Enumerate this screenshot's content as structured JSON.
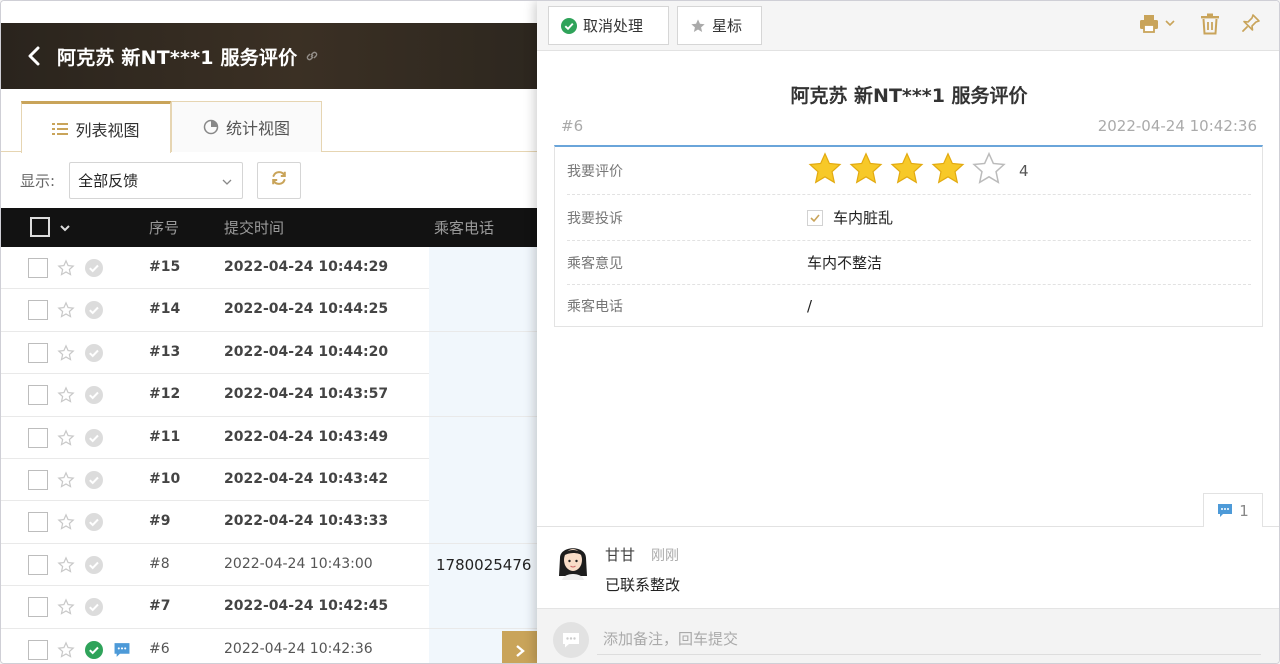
{
  "header": {
    "title": "阿克苏 新NT***1 服务评价"
  },
  "tabs": [
    {
      "label": "列表视图",
      "active": true
    },
    {
      "label": "统计视图",
      "active": false
    }
  ],
  "filter": {
    "label": "显示:",
    "selected": "全部反馈"
  },
  "table": {
    "columns": {
      "seq": "序号",
      "time": "提交时间",
      "phone": "乘客电话"
    },
    "rows": [
      {
        "seq": "#15",
        "time": "2022-04-24 10:44:29",
        "phone": "",
        "unread": true
      },
      {
        "seq": "#14",
        "time": "2022-04-24 10:44:25",
        "phone": "",
        "unread": true
      },
      {
        "seq": "#13",
        "time": "2022-04-24 10:44:20",
        "phone": "",
        "unread": true
      },
      {
        "seq": "#12",
        "time": "2022-04-24 10:43:57",
        "phone": "",
        "unread": true
      },
      {
        "seq": "#11",
        "time": "2022-04-24 10:43:49",
        "phone": "",
        "unread": true
      },
      {
        "seq": "#10",
        "time": "2022-04-24 10:43:42",
        "phone": "",
        "unread": true
      },
      {
        "seq": "#9",
        "time": "2022-04-24 10:43:33",
        "phone": "",
        "unread": true
      },
      {
        "seq": "#8",
        "time": "2022-04-24 10:43:00",
        "phone": "1780025476",
        "unread": false
      },
      {
        "seq": "#7",
        "time": "2022-04-24 10:42:45",
        "phone": "",
        "unread": true
      },
      {
        "seq": "#6",
        "time": "2022-04-24 10:42:36",
        "phone": "",
        "unread": false,
        "selected": true
      }
    ]
  },
  "toolbar": {
    "cancel_label": "取消处理",
    "star_label": "星标"
  },
  "detail": {
    "title": "阿克苏 新NT***1 服务评价",
    "id": "#6",
    "date": "2022-04-24 10:42:36",
    "fields": {
      "rating_label": "我要评价",
      "rating_value": "4",
      "rating_max": 5,
      "complaint_label": "我要投诉",
      "complaint_value": "车内脏乱",
      "opinion_label": "乘客意见",
      "opinion_value": "车内不整洁",
      "phone_label": "乘客电话",
      "phone_value": "/"
    }
  },
  "comments": {
    "count": "1",
    "items": [
      {
        "author": "甘甘",
        "when": "刚刚",
        "text": "已联系整改"
      }
    ]
  },
  "note": {
    "placeholder": "添加备注，回车提交"
  },
  "colors": {
    "accent": "#c9a45a",
    "ok_green": "#2fa35a",
    "star_yellow": "#f7c928",
    "comment_blue": "#4d9ad8",
    "topbar_dark": "#2e2820"
  }
}
